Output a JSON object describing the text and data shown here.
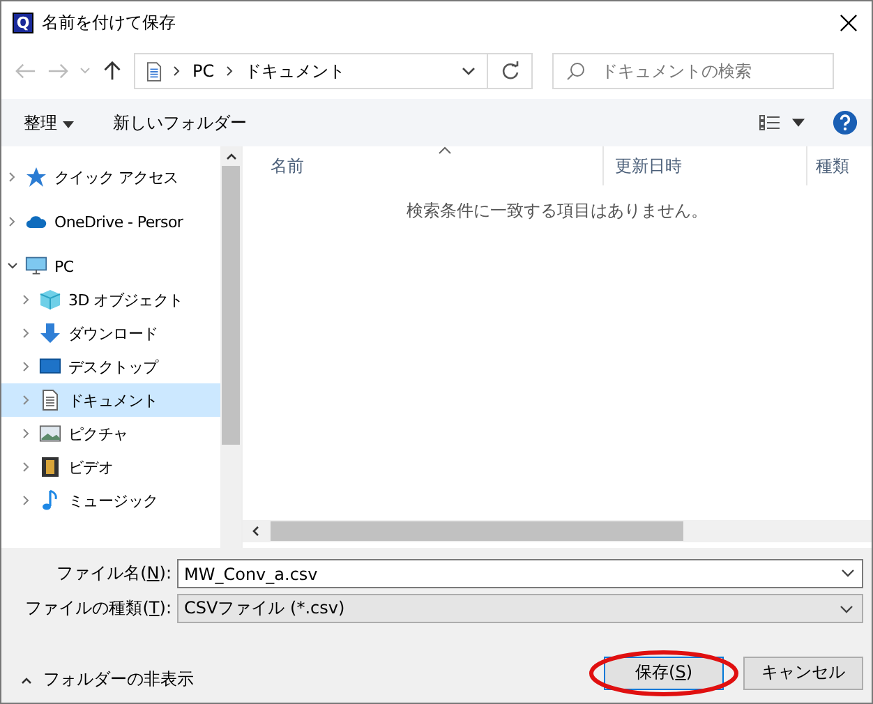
{
  "window": {
    "title": "名前を付けて保存",
    "app_icon": "Q"
  },
  "navigation": {
    "breadcrumb": [
      "PC",
      "ドキュメント"
    ],
    "search": {
      "placeholder": "ドキュメントの検索"
    }
  },
  "toolbar": {
    "organize": "整理",
    "new_folder": "新しいフォルダー"
  },
  "tree": [
    {
      "label": "クイック アクセス",
      "kind": "star",
      "expanded": false,
      "selected": false
    },
    {
      "label": "OneDrive - Persor",
      "kind": "cloud",
      "expanded": false,
      "selected": false
    },
    {
      "label": "PC",
      "kind": "pc",
      "expanded": true,
      "selected": false,
      "children": [
        {
          "label": "3D オブジェクト",
          "kind": "cube",
          "expanded": false,
          "selected": false
        },
        {
          "label": "ダウンロード",
          "kind": "download",
          "expanded": false,
          "selected": false
        },
        {
          "label": "デスクトップ",
          "kind": "desktop",
          "expanded": false,
          "selected": false
        },
        {
          "label": "ドキュメント",
          "kind": "document",
          "expanded": false,
          "selected": true
        },
        {
          "label": "ピクチャ",
          "kind": "pictures",
          "expanded": false,
          "selected": false
        },
        {
          "label": "ビデオ",
          "kind": "video",
          "expanded": false,
          "selected": false
        },
        {
          "label": "ミュージック",
          "kind": "music",
          "expanded": false,
          "selected": false
        }
      ]
    }
  ],
  "file_list": {
    "columns": [
      "名前",
      "更新日時",
      "種類"
    ],
    "empty_message": "検索条件に一致する項目はありません。"
  },
  "fields": [
    {
      "label_before": "ファイル名(",
      "accel": "N",
      "label_after": "):",
      "value": "MW_Conv_a.csv",
      "kind": "combo"
    },
    {
      "label_before": "ファイルの種類(",
      "accel": "T",
      "label_after": "):",
      "value": "CSVファイル (*.csv)",
      "kind": "select"
    }
  ],
  "hide_folders": "フォルダーの非表示",
  "buttons": [
    {
      "before": "保存(",
      "accel": "S",
      "after": ")",
      "kind": "primary",
      "circled": true
    },
    {
      "before": "キャンセル",
      "kind": "normal",
      "circled": false
    }
  ]
}
